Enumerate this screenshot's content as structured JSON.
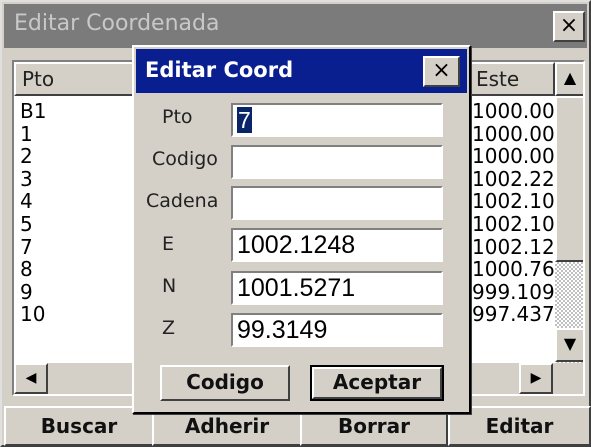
{
  "outer_window": {
    "title": "Editar Coordenada",
    "close_glyph": "×"
  },
  "list": {
    "columns": {
      "pto": "Pto",
      "este": "Este"
    },
    "pto_values": [
      "B1",
      "1",
      "2",
      "3",
      "4",
      "5",
      "7",
      "8",
      "9",
      "10"
    ],
    "este_values": [
      "1000.00",
      "1000.00",
      "1000.00",
      "1002.22",
      "1002.10",
      "1002.10",
      "1002.12",
      "1000.76",
      "999.109",
      "997.437"
    ]
  },
  "scrollbar": {
    "up_icon": "▲",
    "down_icon": "▼",
    "left_icon": "◀",
    "right_icon": "▶"
  },
  "dialog": {
    "title": "Editar Coord",
    "close_glyph": "×",
    "fields": {
      "pto": {
        "label": "Pto",
        "value": "7"
      },
      "codigo": {
        "label": "Codigo",
        "value": ""
      },
      "cadena": {
        "label": "Cadena",
        "value": ""
      },
      "e": {
        "label": "E",
        "value": "1002.1248"
      },
      "n": {
        "label": "N",
        "value": "1001.5271"
      },
      "z": {
        "label": "Z",
        "value": "99.3149"
      }
    },
    "buttons": {
      "codigo": "Codigo",
      "aceptar": "Aceptar"
    }
  },
  "bottom_bar": {
    "buscar": "Buscar",
    "adherir": "Adherir",
    "borrar": "Borrar",
    "editar": "Editar"
  },
  "colors": {
    "dialog_title_bg": "#0a1f8f",
    "outer_title_bg": "#7b7b7b",
    "face": "#d4d0c8",
    "selection": "#0a246a"
  }
}
